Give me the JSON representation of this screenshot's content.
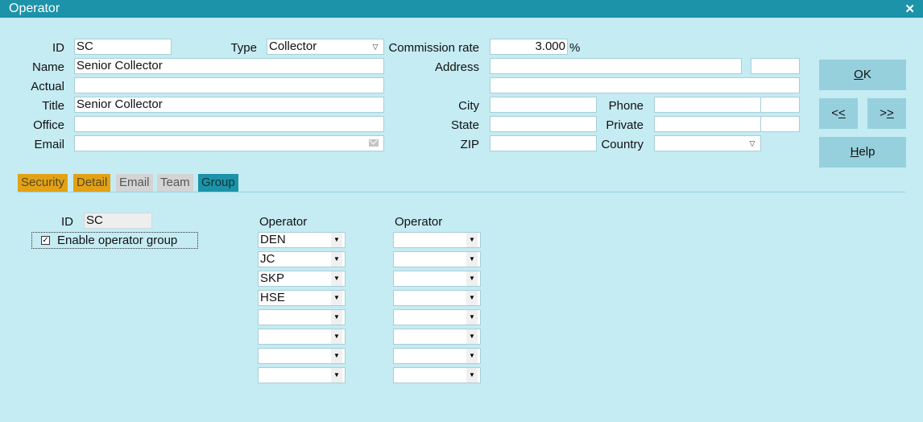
{
  "window": {
    "title": "Operator",
    "close_glyph": "✕",
    "close_icon": "close-icon"
  },
  "form": {
    "labels": {
      "id": "ID",
      "name": "Name",
      "actual": "Actual",
      "title": "Title",
      "office": "Office",
      "email": "Email",
      "type": "Type",
      "commission_rate": "Commission rate",
      "percent": "%",
      "address": "Address",
      "city": "City",
      "state": "State",
      "zip": "ZIP",
      "phone": "Phone",
      "private": "Private",
      "country": "Country"
    },
    "values": {
      "id": "SC",
      "name": "Senior Collector",
      "actual": "",
      "title": "Senior Collector",
      "office": "",
      "email": "",
      "type": "Collector",
      "commission_rate": "3.000",
      "address1": "",
      "address1_extra": "",
      "address2": "",
      "city": "",
      "state": "",
      "zip": "",
      "phone": "",
      "phone_ext": "",
      "private": "",
      "private_ext": "",
      "country": ""
    }
  },
  "buttons": {
    "ok": {
      "underline": "O",
      "rest": "K"
    },
    "prev": {
      "first": "<",
      "underline": "<"
    },
    "next": {
      "first": ">",
      "underline": ">"
    },
    "help": {
      "underline": "H",
      "rest": "elp"
    }
  },
  "tabs": [
    {
      "label": "Security",
      "state": "orange"
    },
    {
      "label": "Detail",
      "state": "orange"
    },
    {
      "label": "Email",
      "state": "grey"
    },
    {
      "label": "Team",
      "state": "grey"
    },
    {
      "label": "Group",
      "state": "active"
    }
  ],
  "group": {
    "id_label": "ID",
    "id_value": "SC",
    "enable_label": "Enable operator group",
    "enable_checked": true,
    "check_glyph": "✓",
    "col1_header": "Operator",
    "col2_header": "Operator",
    "col1_values": [
      "DEN",
      "JC",
      "SKP",
      "HSE",
      "",
      "",
      "",
      ""
    ],
    "col2_values": [
      "",
      "",
      "",
      "",
      "",
      "",
      "",
      ""
    ]
  },
  "colors": {
    "titlebar": "#1c93a9",
    "background": "#c5ebf3",
    "button": "#96d0dc",
    "tab_orange": "#e3a216",
    "tab_active": "#1c93a9"
  }
}
